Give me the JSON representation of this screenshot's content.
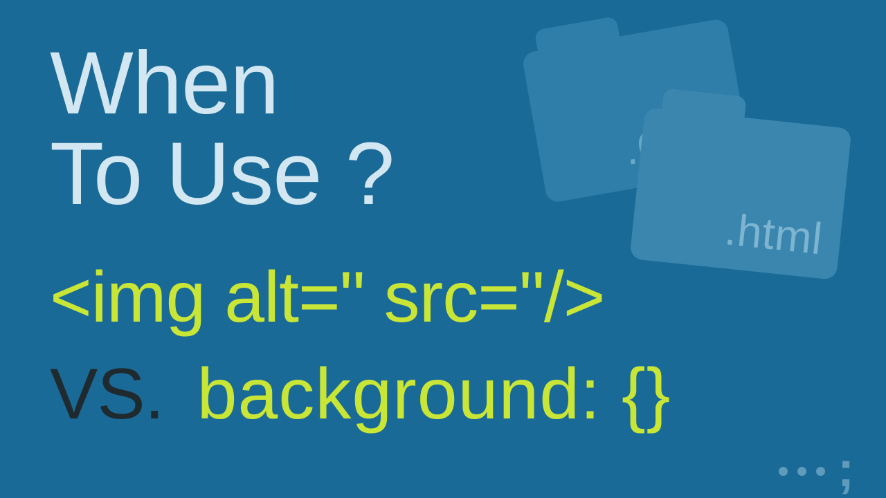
{
  "colors": {
    "background": "#1a6a98",
    "headline": "#d2e7f1",
    "accent": "#c9e636",
    "vs": "#1f2a2f",
    "folder_back": "#2f7da9",
    "folder_front": "#3a86af",
    "watermark": "#5f9bbb"
  },
  "headline": {
    "line1": "When",
    "line2": "To Use ?"
  },
  "comparison": {
    "img_tag": "<img alt=\" src=\"/>",
    "vs_label": "VS.",
    "css_rule": "background: {}"
  },
  "folders": {
    "back_label": ".CSS",
    "front_label": ".html"
  },
  "watermark": {
    "dots": 3,
    "glyph": ";"
  }
}
